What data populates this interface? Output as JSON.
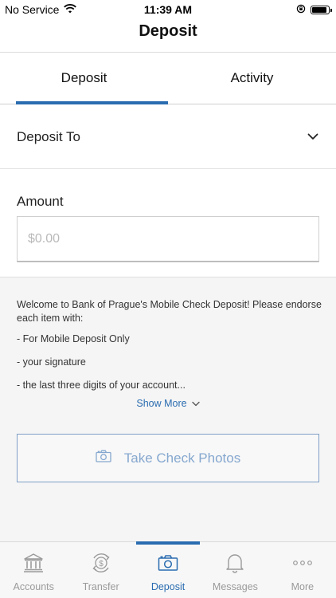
{
  "status_bar": {
    "carrier": "No Service",
    "time": "11:39 AM",
    "battery_level": 0.9
  },
  "header": {
    "title": "Deposit"
  },
  "tabs": [
    {
      "label": "Deposit",
      "active": true
    },
    {
      "label": "Activity",
      "active": false
    }
  ],
  "deposit_to": {
    "label": "Deposit To",
    "icon": "chevron-down-icon"
  },
  "amount": {
    "label": "Amount",
    "placeholder": "$0.00",
    "value": ""
  },
  "info": {
    "intro": "Welcome to Bank of Prague's Mobile Check Deposit! Please endorse each item with:",
    "items": [
      "- For Mobile Deposit Only",
      "- your signature",
      "- the last three digits of your account..."
    ],
    "show_more_label": "Show More"
  },
  "take_photos": {
    "label": "Take Check Photos",
    "icon": "camera-icon"
  },
  "bottom_nav": [
    {
      "label": "Accounts",
      "icon": "bank-icon",
      "active": false
    },
    {
      "label": "Transfer",
      "icon": "transfer-dollar-icon",
      "active": false
    },
    {
      "label": "Deposit",
      "icon": "camera-icon",
      "active": true
    },
    {
      "label": "Messages",
      "icon": "bell-icon",
      "active": false
    },
    {
      "label": "More",
      "icon": "more-dots-icon",
      "active": false
    }
  ],
  "colors": {
    "accent": "#2a6cb0",
    "inactive": "#9a9a9a",
    "button_text": "#86a8cf",
    "section_bg": "#f5f5f5"
  }
}
